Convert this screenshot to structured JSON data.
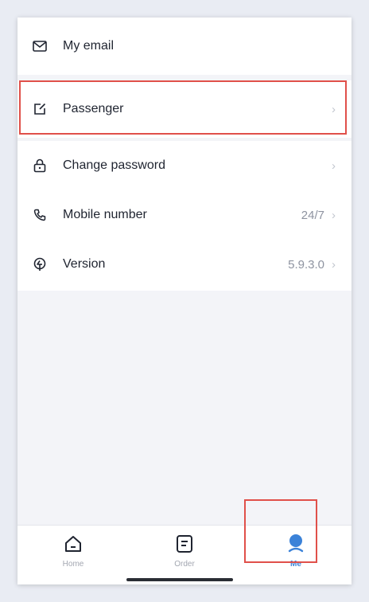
{
  "settings": {
    "items": [
      {
        "label": "My email",
        "icon": "mail-icon",
        "value": ""
      },
      {
        "label": "Passenger",
        "icon": "edit-icon",
        "value": ""
      },
      {
        "label": "Change password",
        "icon": "lock-icon",
        "value": ""
      },
      {
        "label": "Mobile number",
        "icon": "phone-icon",
        "value": "24/7"
      },
      {
        "label": "Version",
        "icon": "version-icon",
        "value": "5.9.3.0"
      }
    ]
  },
  "tabbar": {
    "tabs": [
      {
        "label": "Home",
        "icon": "home-icon"
      },
      {
        "label": "Order",
        "icon": "order-icon"
      },
      {
        "label": "Me",
        "icon": "user-icon",
        "active": true
      }
    ]
  },
  "colors": {
    "accent": "#3b82d8",
    "highlight": "#e0504a",
    "background": "#f3f4f8"
  }
}
